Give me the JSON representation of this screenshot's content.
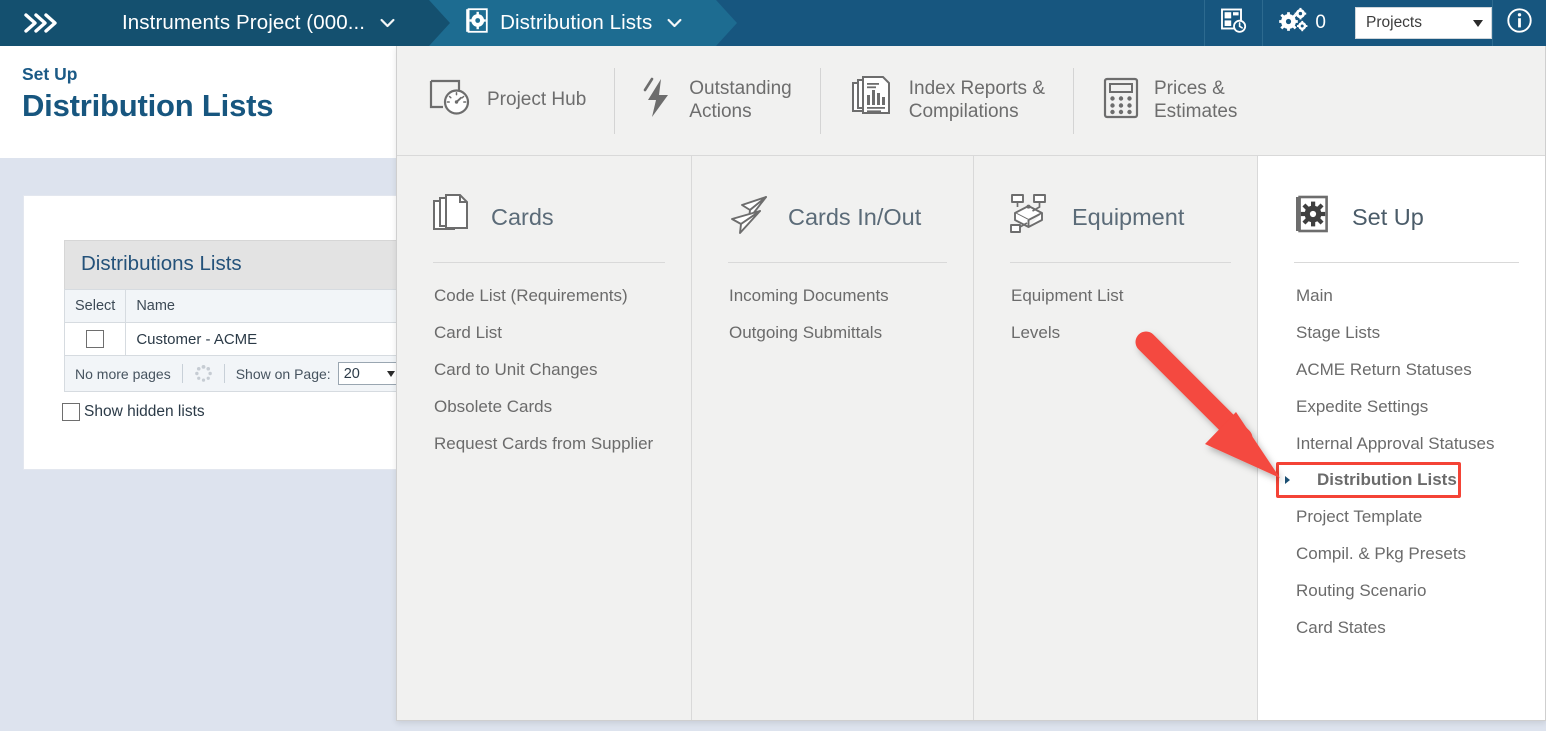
{
  "topbar": {
    "home_icon": "chevrons-right-icon",
    "project_tab": {
      "label": "Instruments Project (000...",
      "caret": "chevron-down-icon"
    },
    "current_tab": {
      "label": "Distribution Lists",
      "icon": "setup-gear-page-icon",
      "caret": "chevron-down-icon"
    },
    "recent_icon": "recent-items-icon",
    "settings_icon": "gears-icon",
    "settings_count": "0",
    "project_select": {
      "value": "Projects",
      "caret": "chevron-down-icon"
    },
    "info_icon": "info-circle-icon",
    "bg_color": "#17567f",
    "active_tab_color": "#1d6c91"
  },
  "page": {
    "eyebrow": "Set Up",
    "title": "Distribution Lists",
    "table": {
      "caption": "Distributions Lists",
      "columns": [
        "Select",
        "Name"
      ],
      "rows": [
        {
          "select": "",
          "name": "Customer - ACME"
        }
      ],
      "footer": {
        "paging": "No more pages",
        "refresh_icon": "loading-spinner-icon",
        "show_on_page_label": "Show on Page:",
        "show_on_page_value": "20"
      }
    },
    "show_hidden_label": "Show hidden lists"
  },
  "mega_menu": {
    "top_items": [
      {
        "label": "Project Hub",
        "icon": "project-hub-gauge-icon"
      },
      {
        "label": "Outstanding\nActions",
        "label_line1": "Outstanding",
        "label_line2": "Actions",
        "icon": "lightning-bolt-icon"
      },
      {
        "label": "Index Reports & Compilations",
        "label_line1": "Index Reports &",
        "label_line2": "Compilations",
        "icon": "stacked-reports-icon"
      },
      {
        "label": "Prices & Estimates",
        "label_line1": "Prices &",
        "label_line2": "Estimates",
        "icon": "calculator-icon"
      }
    ],
    "columns": [
      {
        "title": "Cards",
        "icon": "cards-stack-icon",
        "items": [
          "Code List (Requirements)",
          "Card List",
          "Card to Unit Changes",
          "Obsolete Cards",
          "Request Cards from Supplier"
        ]
      },
      {
        "title": "Cards In/Out",
        "icon": "paper-planes-icon",
        "items": [
          "Incoming Documents",
          "Outgoing Submittals"
        ]
      },
      {
        "title": "Equipment",
        "icon": "equipment-node-icon",
        "items": [
          "Equipment List",
          "Levels"
        ]
      },
      {
        "title": "Set Up",
        "icon": "setup-gear-page-icon",
        "items": [
          "Main",
          "Stage Lists",
          "ACME Return Statuses",
          "Expedite Settings",
          "Internal Approval Statuses",
          "Distribution Lists",
          "Project Template",
          "Compil. & Pkg Presets",
          "Routing Scenario",
          "Card States"
        ],
        "active_item": "Distribution Lists"
      }
    ]
  },
  "annotation": {
    "arrow_icon": "red-arrow-pointer",
    "arrow_color": "#f4483f",
    "highlight_color": "#f44336",
    "target": "Distribution Lists"
  }
}
